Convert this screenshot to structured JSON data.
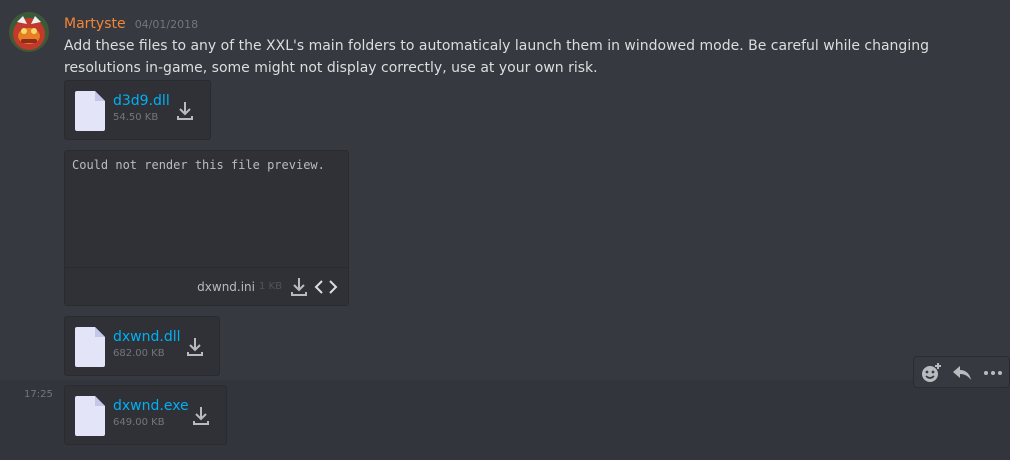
{
  "message": {
    "author": "Martyste",
    "date": "04/01/2018",
    "text": "Add these files to any of the XXL's main folders to automaticaly launch them in windowed mode. Be careful while changing resolutions in-game, some might not display correctly, use at your own risk.",
    "author_color": "#f0853a"
  },
  "attachments": [
    {
      "name": "d3d9.dll",
      "size": "54.50 KB",
      "icon": "file-icon"
    },
    {
      "name": "dxwnd.ini",
      "size": "1 KB",
      "preview_text": "Could not render this file preview.",
      "icon": "file-icon"
    },
    {
      "name": "dxwnd.dll",
      "size": "682.00 KB",
      "icon": "file-icon"
    },
    {
      "name": "dxwnd.exe",
      "size": "649.00 KB",
      "icon": "file-icon"
    }
  ],
  "followup": {
    "time": "17:25"
  },
  "actions": [
    {
      "icon": "add-reaction-icon"
    },
    {
      "icon": "reply-icon"
    },
    {
      "icon": "more-icon"
    }
  ],
  "colors": {
    "background": "#36393f",
    "link": "#00b0f4",
    "hover_row": "#32353b"
  }
}
